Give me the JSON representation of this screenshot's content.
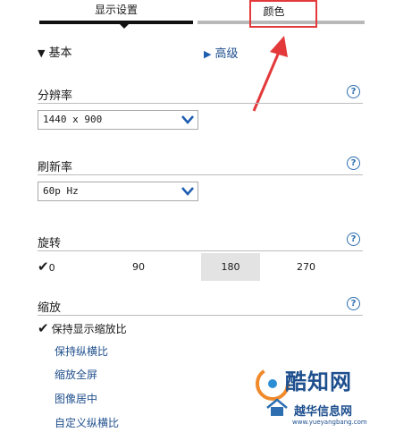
{
  "tabs": {
    "display_settings": "显示设置",
    "color": "颜色"
  },
  "basic_label": "基本",
  "advanced_label": "高级",
  "resolution": {
    "title": "分辨率",
    "value": "1440 x 900"
  },
  "refresh_rate": {
    "title": "刷新率",
    "value": "60p Hz"
  },
  "rotation": {
    "title": "旋转",
    "options": [
      "0",
      "90",
      "180",
      "270"
    ],
    "checked": "0",
    "highlighted": "180"
  },
  "scaling": {
    "title": "缩放",
    "checked_option": "保持显示缩放比",
    "options": [
      "保持纵横比",
      "缩放全屏",
      "图像居中",
      "自定义纵横比"
    ]
  },
  "watermark": {
    "brand": "酷知网",
    "site_name": "越华信息网",
    "url": "www.yueyangbang.com"
  },
  "colors": {
    "accent_blue": "#2c6eaf",
    "highlight_red": "#e3393b"
  },
  "icons": {
    "help": "help-icon",
    "dropdown": "chevron-down-icon",
    "check": "check-icon"
  }
}
